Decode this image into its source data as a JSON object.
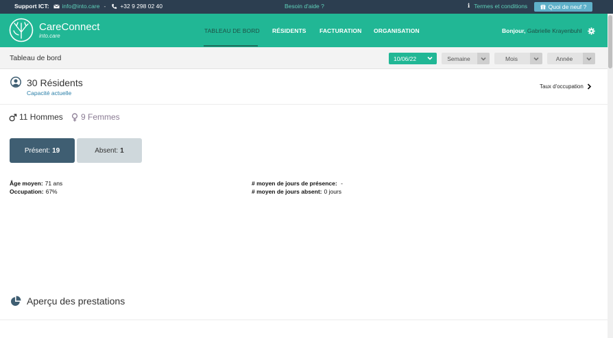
{
  "topbar": {
    "support_label": "Support ICT:",
    "email": "info@into.care",
    "separator": "-",
    "phone": "+32 9 298 02 40",
    "help": "Besoin d'aide ?",
    "terms": "Termes et conditions",
    "news": "Quoi de neuf ?"
  },
  "header": {
    "brand": "CareConnect",
    "brand_sub": "into.care",
    "nav": [
      "TABLEAU DE BORD",
      "RÉSIDENTS",
      "FACTURATION",
      "ORGANISATION"
    ],
    "greeting": "Bonjour,",
    "user_name": "Gabrielle Krayenbuhl"
  },
  "toolbar": {
    "page_title": "Tableau de bord",
    "date": "10/06/22",
    "periods": [
      "Semaine",
      "Mois",
      "Année"
    ]
  },
  "residents": {
    "title": "30 Résidents",
    "subtitle": "Capacité actuelle",
    "occupancy_link": "Taux d'occupation",
    "men": "11 Hommes",
    "women": "9 Femmes",
    "present_label": "Présent:",
    "present_count": "19",
    "absent_label": "Absent:",
    "absent_count": "1"
  },
  "stats": {
    "avg_age_label": "Âge moyen:",
    "avg_age_value": "71 ans",
    "occupation_label": "Occupation:",
    "occupation_value": "67%",
    "avg_presence_label": "# moyen de jours de présence:",
    "avg_presence_value": "-",
    "avg_absent_label": "# moyen de jours absent:",
    "avg_absent_value": "0 jours"
  },
  "prestations": {
    "title": "Aperçu des prestations"
  },
  "colors": {
    "topbar": "#2c3e50",
    "brand_green": "#21b795",
    "link_teal": "#5fd0b9",
    "present_btn": "#3f5e72",
    "absent_btn": "#cfd8dc"
  },
  "icons": {
    "email": "envelope-icon",
    "phone": "phone-icon",
    "info": "info-icon",
    "gift": "gift-icon",
    "settings": "gear-icon",
    "residents": "user-circle-icon",
    "male": "male-icon",
    "female": "female-icon",
    "prestations": "pie-chart-icon"
  }
}
